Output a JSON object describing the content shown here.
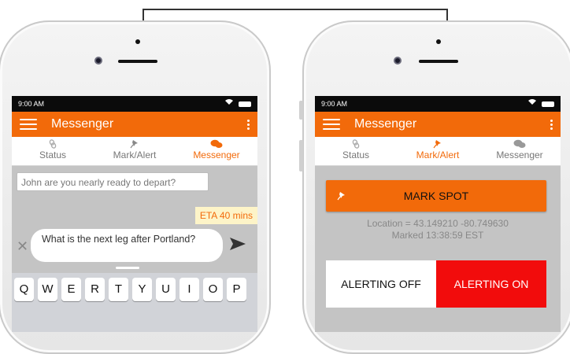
{
  "connector_title": "",
  "left_phone": {
    "status_time": "9:00 AM",
    "app_title": "Messenger",
    "tabs": [
      {
        "label": "Status",
        "icon": "link-icon",
        "active": false
      },
      {
        "label": "Mark/Alert",
        "icon": "pushpin-icon",
        "active": false
      },
      {
        "label": "Messenger",
        "icon": "chat-bubbles-icon",
        "active": true
      }
    ],
    "incoming_message": "John are you nearly ready to depart?",
    "outgoing_message": "ETA 40 mins",
    "compose_text": "What is the next leg after Portland?",
    "keyboard_keys": [
      "Q",
      "W",
      "E",
      "R",
      "T",
      "Y",
      "U",
      "I",
      "O",
      "P"
    ]
  },
  "right_phone": {
    "status_time": "9:00 AM",
    "app_title": "Messenger",
    "tabs": [
      {
        "label": "Status",
        "icon": "link-icon",
        "active": false
      },
      {
        "label": "Mark/Alert",
        "icon": "pushpin-icon",
        "active": true
      },
      {
        "label": "Messenger",
        "icon": "chat-bubbles-icon",
        "active": false
      }
    ],
    "mark_button": "MARK SPOT",
    "location_line": "Location = 43.149210 -80.749630",
    "marked_line": "Marked 13:38:59 EST",
    "alerting_off": "ALERTING OFF",
    "alerting_on": "ALERTING ON"
  },
  "colors": {
    "accent": "#f26a0a",
    "alert_red": "#f20c0c",
    "eta_bg": "#fdf4c8",
    "screen_bg": "#c4c4c4"
  }
}
